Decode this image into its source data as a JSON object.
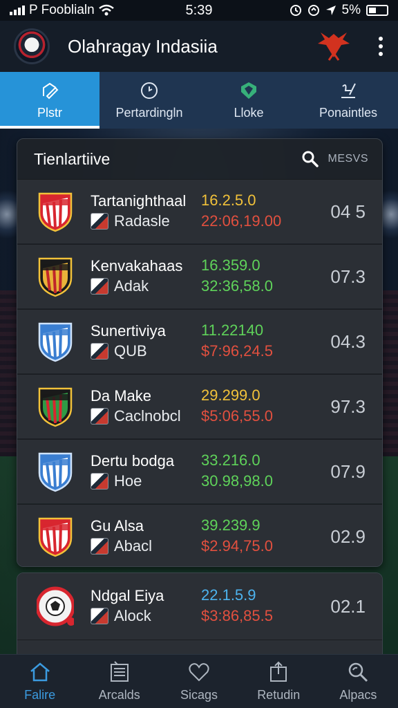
{
  "status_bar": {
    "carrier": "P Fooblialn",
    "time": "5:39",
    "battery": "5%"
  },
  "header": {
    "title": "Olahragay Indasiia",
    "icons": [
      "avatar",
      "phoenix-logo",
      "kebab-menu-icon"
    ]
  },
  "tabs": [
    {
      "label": "Plstr",
      "icon": "pencil-edit-icon",
      "active": true
    },
    {
      "label": "Pertardingln",
      "icon": "clock-icon",
      "active": false
    },
    {
      "label": "Lloke",
      "icon": "shield-icon",
      "active": false
    },
    {
      "label": "Ponaintles",
      "icon": "chart-icon",
      "active": false
    }
  ],
  "panel": {
    "title": "Tienlartiive",
    "search_label": "MESVS"
  },
  "matches": [
    {
      "home": "Tartanighthaal",
      "away": "Radasle",
      "odd_top": "16.2.5.0",
      "odd_bottom": "22:06,19.00",
      "top_color": "#f2c23a",
      "bottom_color": "#e2503f",
      "score": "04 5",
      "crest": "red-white"
    },
    {
      "home": "Kenvakahaas",
      "away": "Adak",
      "odd_top": "16.359.0",
      "odd_bottom": "32:36,58.0",
      "top_color": "#5fd35a",
      "bottom_color": "#5fd35a",
      "score": "07.3",
      "crest": "dark-gold"
    },
    {
      "home": "Sunertiviya",
      "away": "QUB",
      "odd_top": "11.22140",
      "odd_bottom": "$7:96,24.5",
      "top_color": "#5fd35a",
      "bottom_color": "#e2503f",
      "score": "04.3",
      "crest": "blue-white"
    },
    {
      "home": "Da Make",
      "away": "Caclnobcl",
      "odd_top": "29.299.0",
      "odd_bottom": "$5:06,55.0",
      "top_color": "#f2c23a",
      "bottom_color": "#e2503f",
      "score": "97.3",
      "crest": "green-red"
    },
    {
      "home": "Dertu bodga",
      "away": "Hoe",
      "odd_top": "33.216.0",
      "odd_bottom": "30.98,98.0",
      "top_color": "#5fd35a",
      "bottom_color": "#5fd35a",
      "score": "07.9",
      "crest": "blue-white"
    },
    {
      "home": "Gu Alsa",
      "away": "Abacl",
      "odd_top": "39.239.9",
      "odd_bottom": "$2.94,75.0",
      "top_color": "#5fd35a",
      "bottom_color": "#e2503f",
      "score": "02.9",
      "crest": "red-white"
    }
  ],
  "extra_match": {
    "home": "Ndgal Eiya",
    "away": "Alock",
    "odd_top": "22.1.5.9",
    "odd_bottom": "$3:86,85.5",
    "top_color": "#4db3ee",
    "bottom_color": "#e2503f",
    "score": "02.1",
    "crest": "ball"
  },
  "bottom_nav": [
    {
      "label": "Falire",
      "icon": "home-icon",
      "active": true
    },
    {
      "label": "Arcalds",
      "icon": "list-icon",
      "active": false
    },
    {
      "label": "Sicags",
      "icon": "heart-icon",
      "active": false
    },
    {
      "label": "Retudin",
      "icon": "share-icon",
      "active": false
    },
    {
      "label": "Alpacs",
      "icon": "search-icon",
      "active": false
    }
  ]
}
